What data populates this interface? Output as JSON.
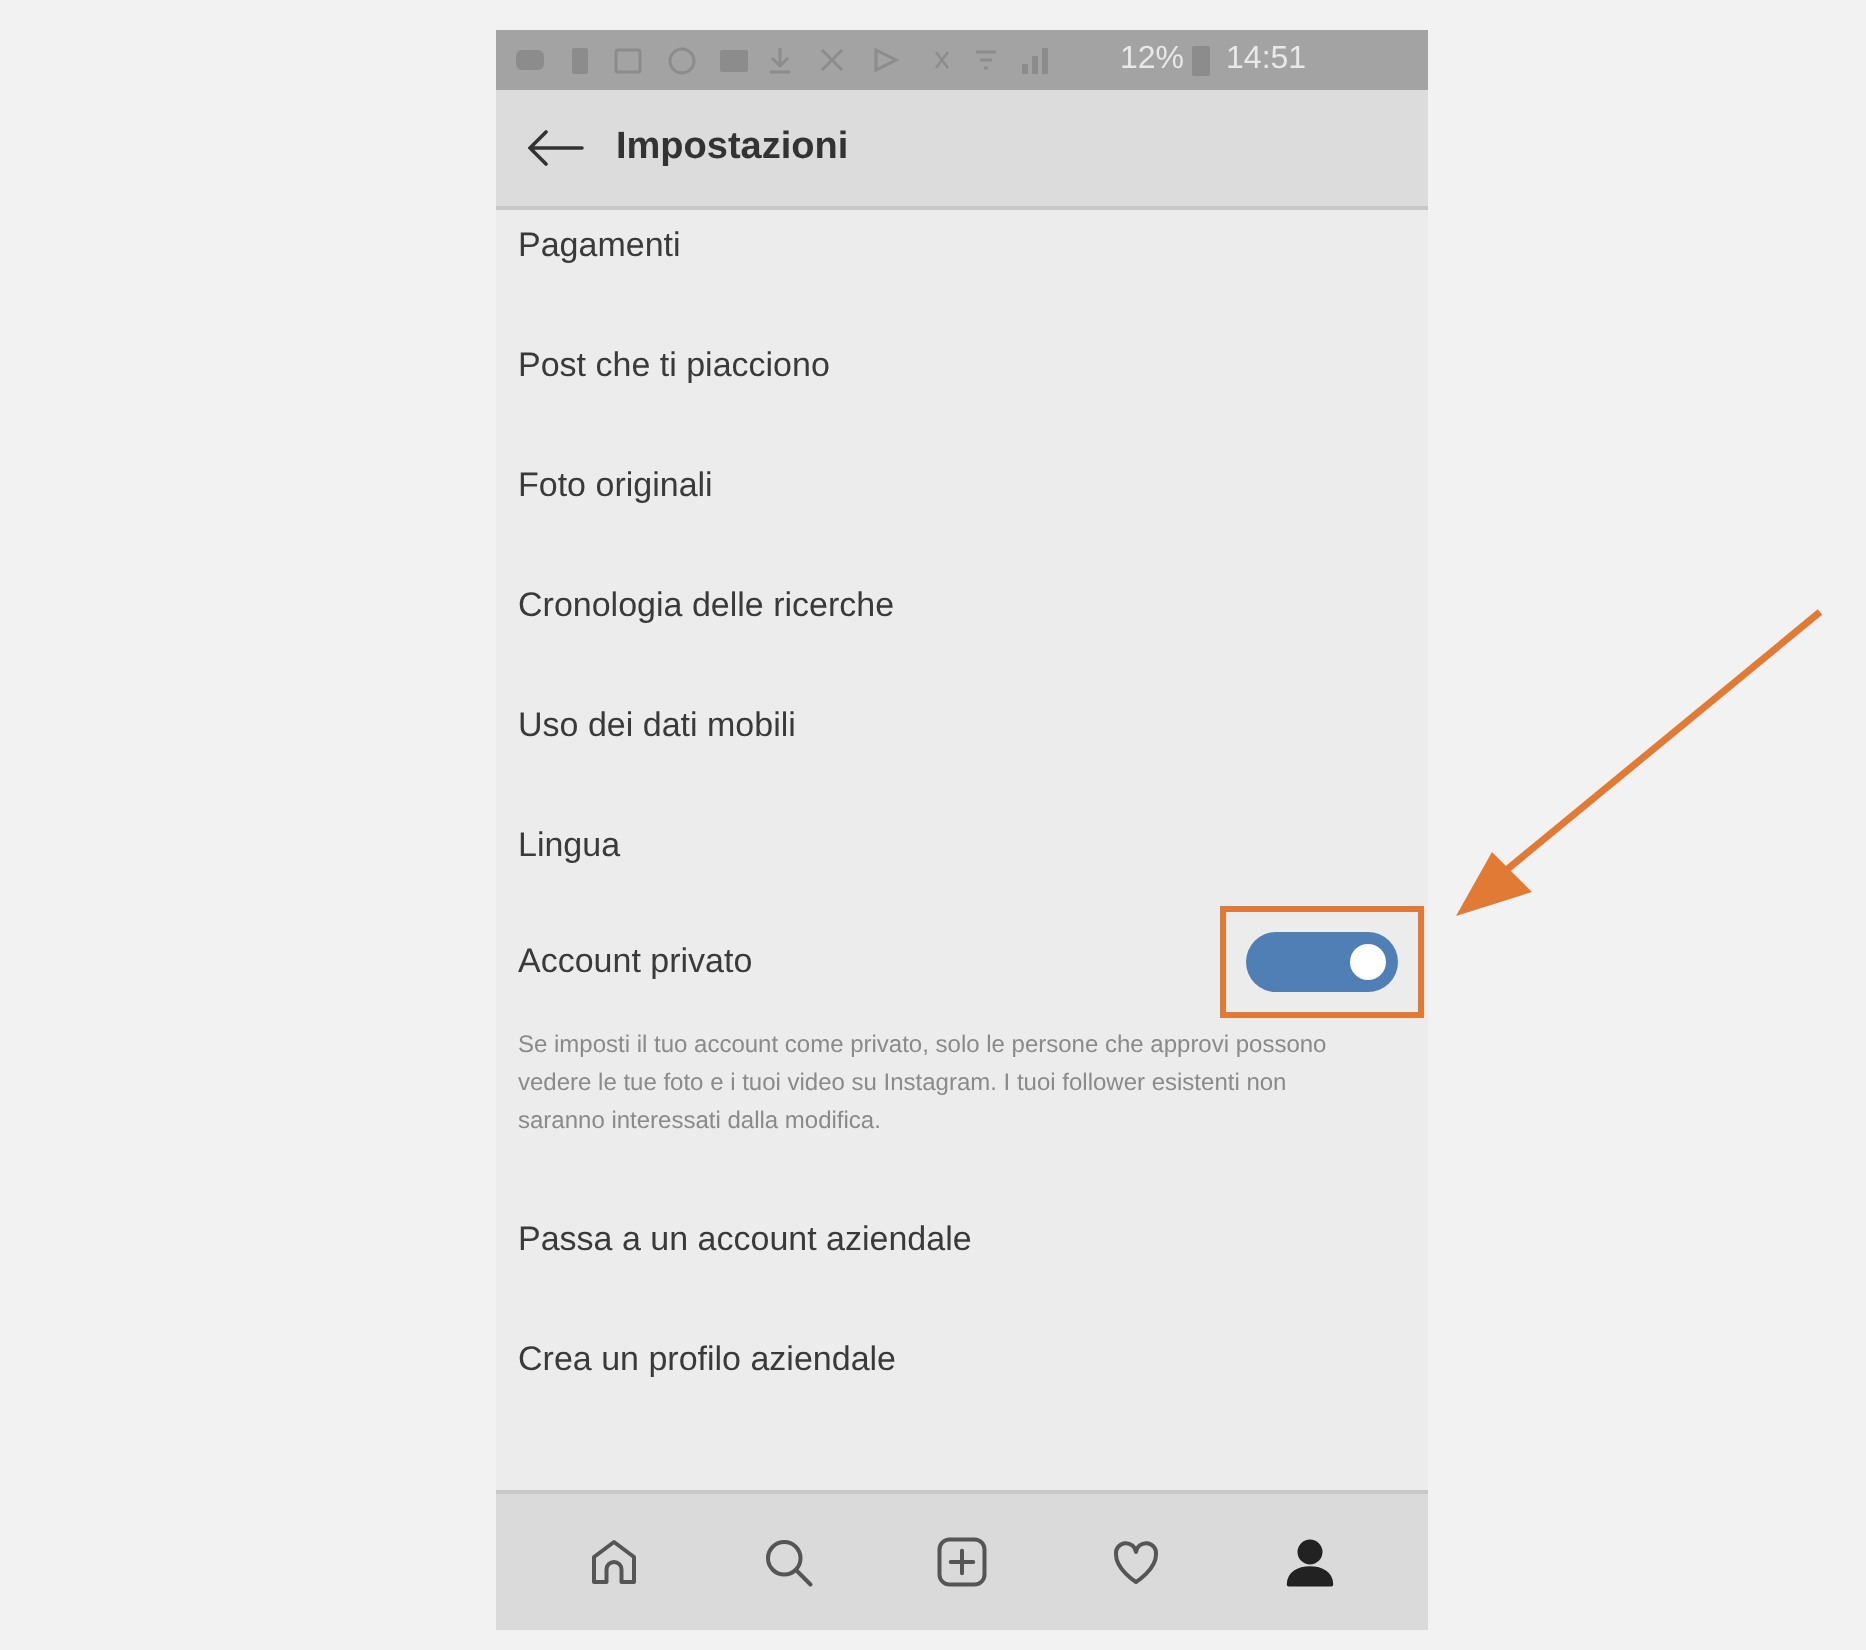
{
  "status_bar": {
    "battery": "12%",
    "time": "14:51"
  },
  "header": {
    "title": "Impostazioni"
  },
  "settings": [
    {
      "kind": "link",
      "label": "Pagamenti"
    },
    {
      "kind": "link",
      "label": "Post che ti piacciono"
    },
    {
      "kind": "link",
      "label": "Foto originali"
    },
    {
      "kind": "link",
      "label": "Cronologia delle ricerche"
    },
    {
      "kind": "link",
      "label": "Uso dei dati mobili"
    },
    {
      "kind": "link",
      "label": "Lingua"
    },
    {
      "kind": "toggle",
      "label": "Account privato",
      "on": true,
      "highlighted": true,
      "description": "Se imposti il tuo account come privato, solo le persone che approvi possono vedere le tue foto e i tuoi video su Instagram. I tuoi follower esistenti non saranno interessati dalla modifica."
    },
    {
      "kind": "link",
      "label": "Passa a un account aziendale"
    },
    {
      "kind": "link",
      "label": "Crea un profilo aziendale"
    }
  ],
  "nav": [
    {
      "kind": "home",
      "selected": false
    },
    {
      "kind": "search",
      "selected": false
    },
    {
      "kind": "add",
      "selected": false
    },
    {
      "kind": "heart",
      "selected": false
    },
    {
      "kind": "profile",
      "selected": true
    }
  ]
}
